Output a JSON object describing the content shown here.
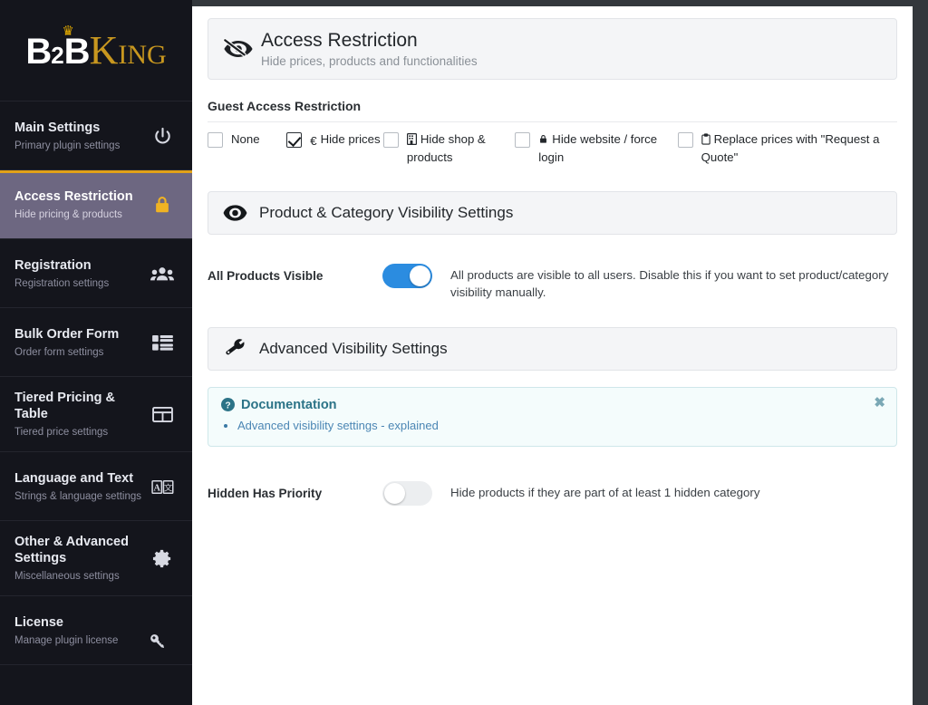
{
  "brand": {
    "logo_part1": "B",
    "logo_sub": "2",
    "logo_part2": "B",
    "logo_k": "K",
    "logo_ing": "ING",
    "crown_icon": "crown-icon"
  },
  "sidebar": {
    "items": [
      {
        "title": "Main Settings",
        "sub": "Primary plugin settings",
        "icon": "power-icon",
        "active": false
      },
      {
        "title": "Access Restriction",
        "sub": "Hide pricing & products",
        "icon": "lock-icon",
        "active": true
      },
      {
        "title": "Registration",
        "sub": "Registration settings",
        "icon": "users-icon",
        "active": false
      },
      {
        "title": "Bulk Order Form",
        "sub": "Order form settings",
        "icon": "list-grid-icon",
        "active": false
      },
      {
        "title": "Tiered Pricing & Table",
        "sub": "Tiered price settings",
        "icon": "table-icon",
        "active": false
      },
      {
        "title": "Language and Text",
        "sub": "Strings & language settings",
        "icon": "translate-icon",
        "active": false
      },
      {
        "title": "Other & Advanced Settings",
        "sub": "Miscellaneous settings",
        "icon": "gear-icon",
        "active": false
      },
      {
        "title": "License",
        "sub": "Manage plugin license",
        "icon": "key-icon",
        "active": false
      }
    ]
  },
  "page_header": {
    "icon": "eye-slash-icon",
    "title": "Access Restriction",
    "subtitle": "Hide prices, products and functionalities"
  },
  "guest_access": {
    "group_title": "Guest Access Restriction",
    "options": [
      {
        "label": "None",
        "icon": null,
        "checked": false
      },
      {
        "label": "Hide prices",
        "icon": "euro-icon",
        "checked": true
      },
      {
        "label": "Hide shop & products",
        "icon": "building-icon",
        "checked": false
      },
      {
        "label": "Hide website / force login",
        "icon": "lock-icon",
        "checked": false
      },
      {
        "label": "Replace prices with \"Request a Quote\"",
        "icon": "clipboard-icon",
        "checked": false
      }
    ]
  },
  "visibility_section": {
    "icon": "eye-icon",
    "title": "Product & Category Visibility Settings",
    "toggle": {
      "label": "All Products Visible",
      "state": "on",
      "description": "All products are visible to all users. Disable this if you want to set product/category visibility manually."
    }
  },
  "advanced_section": {
    "icon": "wrench-icon",
    "title": "Advanced Visibility Settings",
    "documentation": {
      "icon": "question-circle-icon",
      "title": "Documentation",
      "links": [
        "Advanced visibility settings - explained"
      ],
      "close_icon": "close-icon",
      "close_label": "✖"
    },
    "toggle": {
      "label": "Hidden Has Priority",
      "state": "off",
      "description": "Hide products if they are part of at least 1 hidden category"
    }
  },
  "colors": {
    "sidebar_bg": "#14151c",
    "sidebar_active_bg": "#6d6781",
    "accent_gold": "#e2a117",
    "toggle_on": "#2b8ce0",
    "doc_border": "#cfe7ea",
    "doc_title": "#2c7387",
    "link": "#4b86b4"
  }
}
